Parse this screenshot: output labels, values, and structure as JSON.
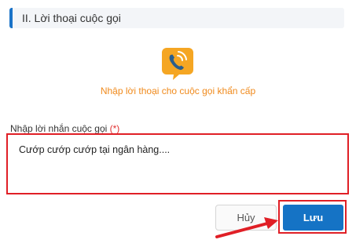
{
  "section": {
    "title": "II. Lời thoại cuộc gọi"
  },
  "intro": {
    "icon": "phone-call-icon",
    "caption": "Nhập lời thoại cho cuộc gọi khẩn cấp"
  },
  "message_field": {
    "label": "Nhập lời nhắn cuộc gọi",
    "required_mark": "(*)",
    "value": "Cướp cướp cướp tại ngân hàng...."
  },
  "actions": {
    "cancel_label": "Hủy",
    "save_label": "Lưu"
  },
  "colors": {
    "accent": "#1573c5",
    "highlight": "#e01f26",
    "caption": "#f08a1c"
  }
}
